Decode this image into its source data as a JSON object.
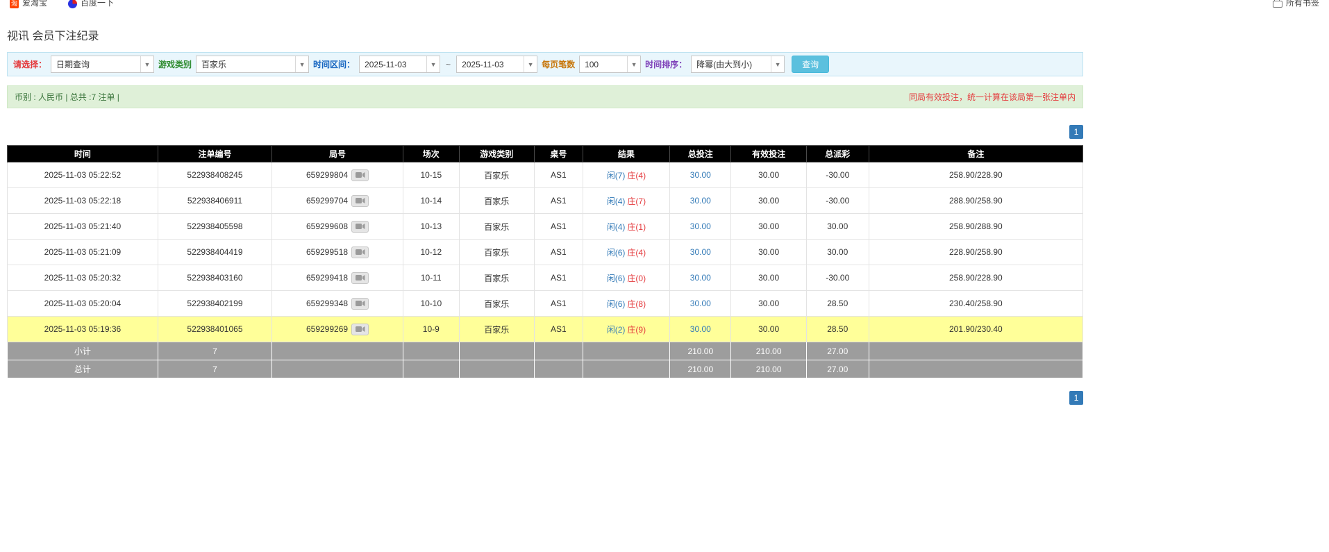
{
  "colors": {
    "link_blue": "#337ab7",
    "negative_red": "#e4393c",
    "result_player_blue": "#337ab7",
    "result_banker_red": "#e4393c",
    "highlight_yellow": "#ffff99",
    "table_header_bg": "#000000",
    "summary_row_gray": "#9d9d9d",
    "filter_bar_bg": "#e9f6fc",
    "notice_bar_bg": "#dff0d8",
    "search_button_bg": "#5bc0de",
    "pagination_bg": "#337ab7"
  },
  "bookmarks_bar": {
    "items": [
      {
        "label": "爱淘宝",
        "icon": "taobao-icon"
      },
      {
        "label": "百度一下",
        "icon": "baidu-icon"
      }
    ],
    "all_bookmarks_label": "所有书签"
  },
  "page": {
    "title": "视讯 会员下注纪录"
  },
  "filters": {
    "select_label": "请选择：",
    "select_value": "日期查询",
    "game_type_label": "游戏类别",
    "game_type_value": "百家乐",
    "time_range_label": "时间区间：",
    "date_from": "2025-11-03",
    "range_separator": "~",
    "date_to": "2025-11-03",
    "page_size_label": "每页笔数",
    "page_size_value": "100",
    "sort_label": "时间排序：",
    "sort_value": "降幂(由大到小)",
    "search_button_label": "查询"
  },
  "notice_bar": {
    "left_text": "币别 : 人民币 | 总共 :7 注单 |",
    "right_text": "同局有效投注，统一计算在该局第一张注单内"
  },
  "pagination": {
    "page_label": "1"
  },
  "table": {
    "headers": [
      "时间",
      "注单编号",
      "局号",
      "场次",
      "游戏类别",
      "桌号",
      "结果",
      "总投注",
      "有效投注",
      "总派彩",
      "备注"
    ],
    "rows": [
      {
        "time": "2025-11-03 05:22:52",
        "bet_id": "522938408245",
        "round": "659299804",
        "session": "10-15",
        "game": "百家乐",
        "table_no": "AS1",
        "result_player": "闲(7)",
        "result_banker": "庄(4)",
        "total_bet": "30.00",
        "valid_bet": "30.00",
        "payout": "-30.00",
        "note": "258.90/228.90",
        "highlight": false
      },
      {
        "time": "2025-11-03 05:22:18",
        "bet_id": "522938406911",
        "round": "659299704",
        "session": "10-14",
        "game": "百家乐",
        "table_no": "AS1",
        "result_player": "闲(4)",
        "result_banker": "庄(7)",
        "total_bet": "30.00",
        "valid_bet": "30.00",
        "payout": "-30.00",
        "note": "288.90/258.90",
        "highlight": false
      },
      {
        "time": "2025-11-03 05:21:40",
        "bet_id": "522938405598",
        "round": "659299608",
        "session": "10-13",
        "game": "百家乐",
        "table_no": "AS1",
        "result_player": "闲(4)",
        "result_banker": "庄(1)",
        "total_bet": "30.00",
        "valid_bet": "30.00",
        "payout": "30.00",
        "note": "258.90/288.90",
        "highlight": false
      },
      {
        "time": "2025-11-03 05:21:09",
        "bet_id": "522938404419",
        "round": "659299518",
        "session": "10-12",
        "game": "百家乐",
        "table_no": "AS1",
        "result_player": "闲(6)",
        "result_banker": "庄(4)",
        "total_bet": "30.00",
        "valid_bet": "30.00",
        "payout": "30.00",
        "note": "228.90/258.90",
        "highlight": false
      },
      {
        "time": "2025-11-03 05:20:32",
        "bet_id": "522938403160",
        "round": "659299418",
        "session": "10-11",
        "game": "百家乐",
        "table_no": "AS1",
        "result_player": "闲(6)",
        "result_banker": "庄(0)",
        "total_bet": "30.00",
        "valid_bet": "30.00",
        "payout": "-30.00",
        "note": "258.90/228.90",
        "highlight": false
      },
      {
        "time": "2025-11-03 05:20:04",
        "bet_id": "522938402199",
        "round": "659299348",
        "session": "10-10",
        "game": "百家乐",
        "table_no": "AS1",
        "result_player": "闲(6)",
        "result_banker": "庄(8)",
        "total_bet": "30.00",
        "valid_bet": "30.00",
        "payout": "28.50",
        "note": "230.40/258.90",
        "highlight": false
      },
      {
        "time": "2025-11-03 05:19:36",
        "bet_id": "522938401065",
        "round": "659299269",
        "session": "10-9",
        "game": "百家乐",
        "table_no": "AS1",
        "result_player": "闲(2)",
        "result_banker": "庄(9)",
        "total_bet": "30.00",
        "valid_bet": "30.00",
        "payout": "28.50",
        "note": "201.90/230.40",
        "highlight": true
      }
    ],
    "subtotal": {
      "label": "小计",
      "count": "7",
      "total_bet": "210.00",
      "valid_bet": "210.00",
      "payout": "27.00"
    },
    "total": {
      "label": "总计",
      "count": "7",
      "total_bet": "210.00",
      "valid_bet": "210.00",
      "payout": "27.00"
    }
  }
}
